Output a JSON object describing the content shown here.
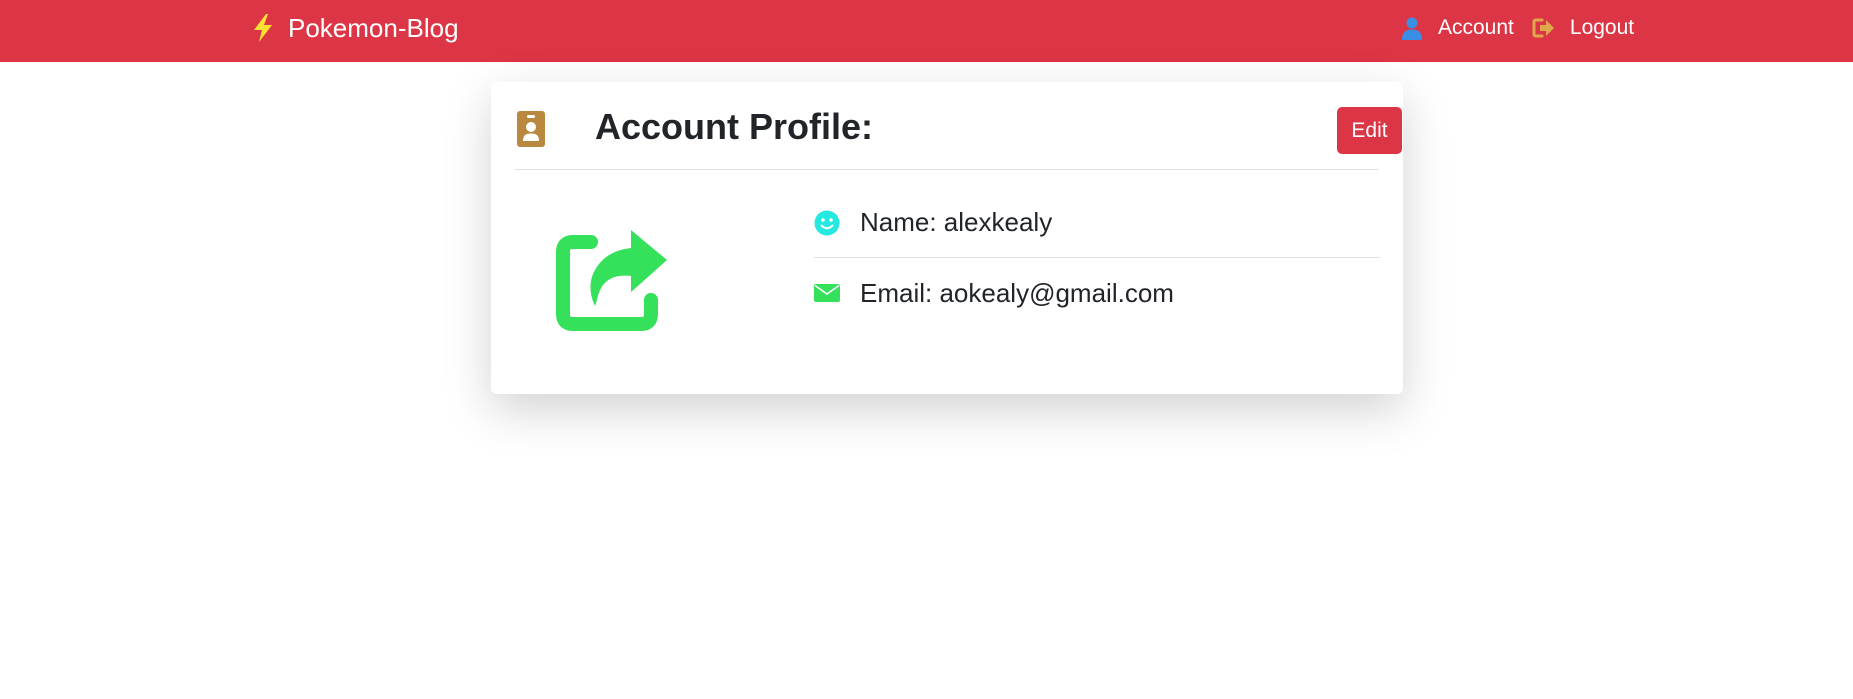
{
  "navbar": {
    "brand": "Pokemon-Blog",
    "account_label": "Account",
    "logout_label": "Logout"
  },
  "profile": {
    "title": "Account Profile:",
    "edit_label": "Edit",
    "name_text": "Name: alexkealy",
    "email_text": "Email: aokealy@gmail.com"
  },
  "icons": {
    "brand": "lightning-bolt-icon",
    "account": "user-icon",
    "logout": "sign-out-icon",
    "profile": "id-badge-icon",
    "avatar": "share-square-icon",
    "name": "smile-icon",
    "email": "envelope-icon"
  },
  "colors": {
    "navbar_bg": "#dc3545",
    "button_bg": "#dc3545",
    "bolt": "#ffe135",
    "user_icon": "#3a8ee6",
    "logout_icon": "#e0a84b",
    "badge_icon": "#b8893f",
    "avatar_icon": "#35e05a",
    "smile_icon": "#25e8e0",
    "envelope_icon": "#35e05a"
  }
}
